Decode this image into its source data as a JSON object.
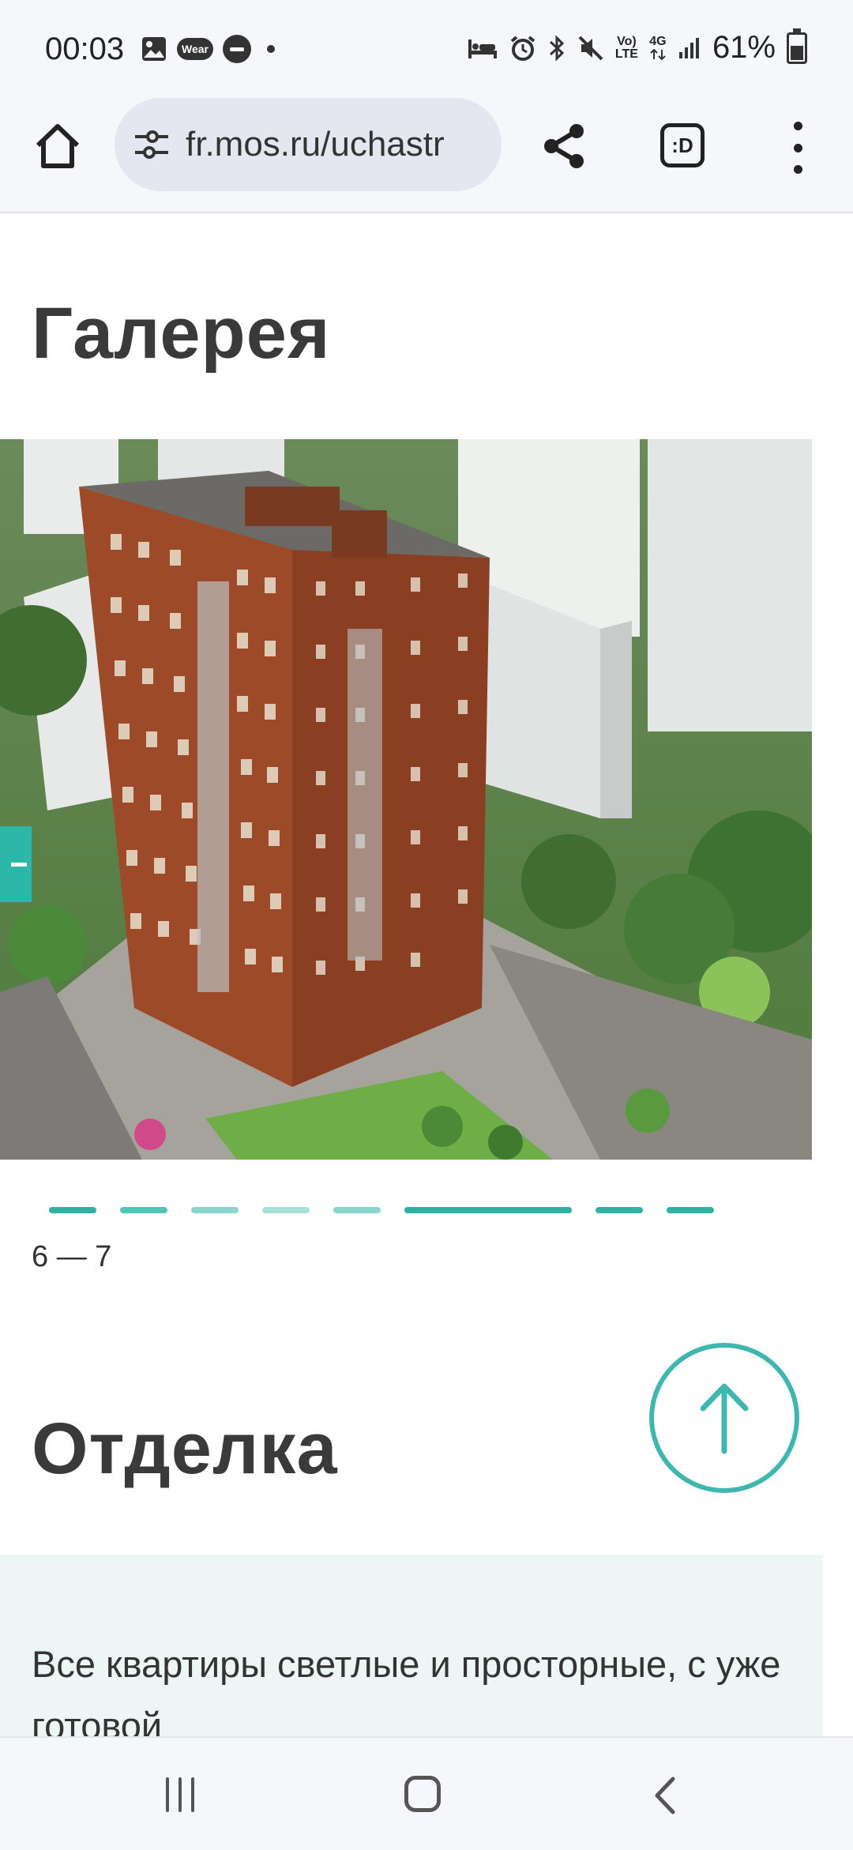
{
  "status_bar": {
    "time": "00:03",
    "wear_badge": "Wear",
    "network_top": "Vo)",
    "network_bottom": "LTE",
    "network_4g": "4G",
    "battery_percent": "61%",
    "icons_left": [
      "image-icon",
      "wear-icon",
      "do-not-disturb-icon",
      "dot-icon"
    ],
    "icons_right": [
      "sleep-mode-icon",
      "alarm-icon",
      "bluetooth-icon",
      "mute-icon",
      "volte-icon",
      "data-4g-icon",
      "signal-icon",
      "battery-icon"
    ]
  },
  "browser": {
    "url": "fr.mos.ru/uchastr",
    "extension_label": ":D"
  },
  "gallery": {
    "title": "Галерея",
    "counter": "6 — 7",
    "accent_color": "#2bb8a8"
  },
  "finish": {
    "title": "Отделка",
    "text": "Все квартиры светлые и просторные, с уже готовой"
  }
}
